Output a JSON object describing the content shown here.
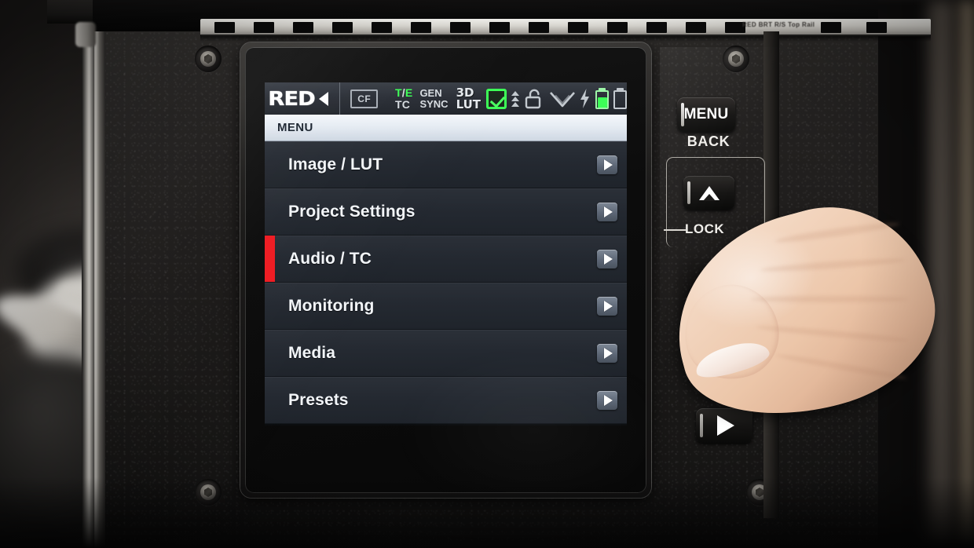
{
  "device": {
    "brand": "RED",
    "screen_title": "MENU"
  },
  "status_bar": {
    "logo_text": "RED",
    "logo_chevron_icon": "chevron-left-icon",
    "media_slot_label": "CF",
    "timecode": {
      "line1": "T/E",
      "line1_left": "T",
      "line1_slash": "/",
      "line1_right": "E",
      "line2": "TC"
    },
    "genlock": {
      "line1": "GEN",
      "line2": "SYNC"
    },
    "lut": {
      "line1": "3D",
      "line2": "LUT"
    },
    "checkbox_icon": "green-checkbox-icon",
    "chevron_stack_icon": "chevron-up-stack-icon",
    "lock_icon": "unlocked-padlock-icon",
    "wifi_icon": "wifi-icon",
    "power_icon": "lightning-bolt-icon",
    "battery_a": {
      "icon": "battery-icon",
      "level_percent": 62,
      "state": "charged"
    },
    "battery_b": {
      "icon": "battery-icon",
      "level_percent": 0,
      "state": "empty"
    }
  },
  "menu": {
    "header": "MENU",
    "items": [
      {
        "label": "Image / LUT",
        "selected": false,
        "arrow_icon": "arrow-right-icon"
      },
      {
        "label": "Project Settings",
        "selected": false,
        "arrow_icon": "arrow-right-icon"
      },
      {
        "label": "Audio / TC",
        "selected": true,
        "arrow_icon": "arrow-right-icon"
      },
      {
        "label": "Monitoring",
        "selected": false,
        "arrow_icon": "arrow-right-icon"
      },
      {
        "label": "Media",
        "selected": false,
        "arrow_icon": "arrow-right-icon"
      },
      {
        "label": "Presets",
        "selected": false,
        "arrow_icon": "arrow-right-icon"
      }
    ]
  },
  "hardware_buttons": {
    "menu_button": "MENU",
    "back_label": "BACK",
    "up_button_icon": "arrow-up-icon",
    "lock_label": "LOCK",
    "play_button_icon": "play-icon"
  },
  "top_rail": {
    "engraved_text": "RED BRT R/S Top Rail"
  },
  "colors": {
    "selection_red": "#ef1b22",
    "status_green": "#3dff57",
    "menu_row_bg": "#242931",
    "title_bar_bg": "#e6ecf3",
    "body_black": "#1d1b1a"
  }
}
